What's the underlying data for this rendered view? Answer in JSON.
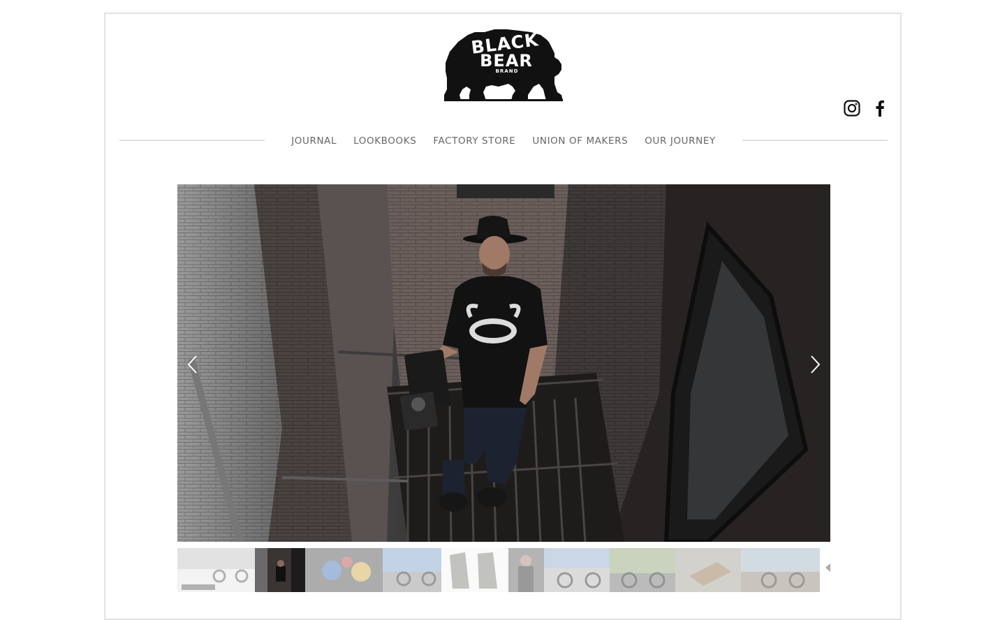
{
  "brand": {
    "word1": "BLACK",
    "word2": "BEAR",
    "word3": "BRAND"
  },
  "social": {
    "instagram_icon": "instagram-icon",
    "facebook_icon": "facebook-icon"
  },
  "nav": {
    "items": [
      {
        "label": "JOURNAL"
      },
      {
        "label": "LOOKBOOKS"
      },
      {
        "label": "FACTORY STORE"
      },
      {
        "label": "UNION OF MAKERS"
      },
      {
        "label": "OUR JOURNEY"
      }
    ]
  },
  "slideshow": {
    "prev_icon": "chevron-left-icon",
    "next_icon": "chevron-right-icon",
    "active_index": 1,
    "thumbnail_count": 10
  },
  "colors": {
    "text": "#666666",
    "divider": "#e0e0e0",
    "logo": "#111111"
  }
}
